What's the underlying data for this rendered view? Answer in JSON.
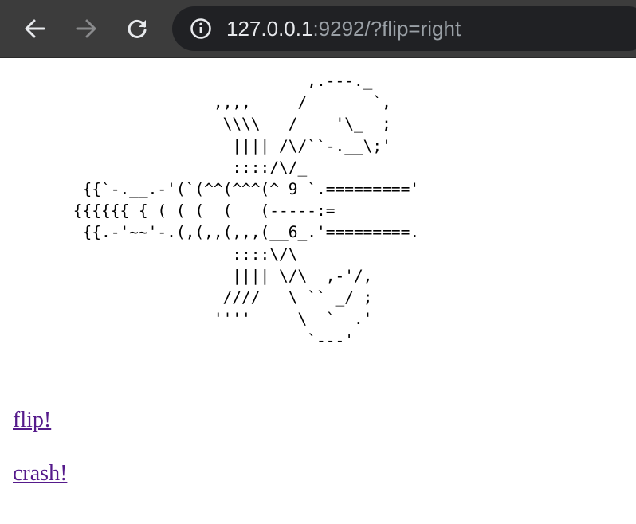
{
  "browser": {
    "url_host": "127.0.0.1",
    "url_rest": ":9292/?flip=right",
    "icons": {
      "back": "arrow-left-icon",
      "forward": "arrow-right-icon",
      "reload": "reload-icon",
      "info": "info-icon"
    }
  },
  "page": {
    "ascii_art": "                          ,.---._\n                ,,,,     /       `,\n                 \\\\\\\\   /    '\\_  ;\n                  |||| /\\/``-.__\\;'\n                  ::::/\\/_\n  {{`-.__.-'(`(^^(^^^(^ 9 `.========='\n {{{{{{ { ( ( (  (   (-----:=\n  {{.-'~~'-.(,(,,(,,,(__6_.'=========.\n                  ::::\\/\\\n                  |||| \\/\\  ,-'/,\n                 ////   \\ `` _/ ;\n                ''''     \\  `  .'\n                          `---'",
    "links": {
      "flip": "flip!",
      "crash": "crash!"
    }
  }
}
